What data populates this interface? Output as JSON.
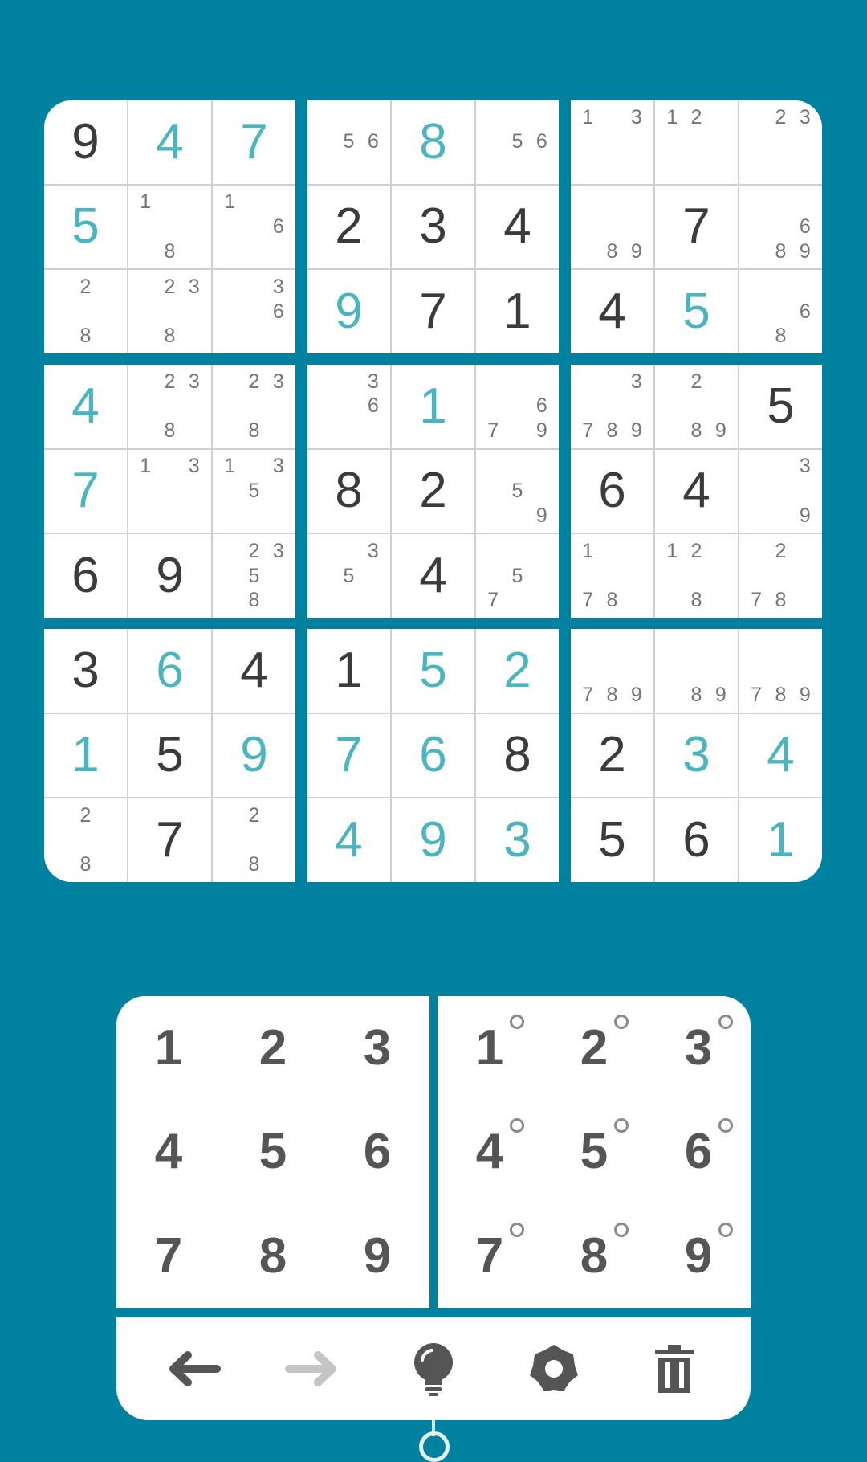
{
  "colors": {
    "background": "#00819f",
    "given": "#3b3b3b",
    "entered": "#4ab4bf",
    "notes": "#757575"
  },
  "board": [
    [
      {
        "v": "9",
        "t": "given"
      },
      {
        "v": "4",
        "t": "entered"
      },
      {
        "v": "7",
        "t": "entered"
      },
      {
        "n": [
          "5",
          "6"
        ]
      },
      {
        "v": "8",
        "t": "entered"
      },
      {
        "n": [
          "5",
          "6"
        ]
      },
      {
        "n": [
          "1",
          "3"
        ]
      },
      {
        "n": [
          "1",
          "2"
        ]
      },
      {
        "n": [
          "2",
          "3"
        ]
      }
    ],
    [
      {
        "v": "5",
        "t": "entered"
      },
      {
        "n": [
          "1",
          "8"
        ]
      },
      {
        "n": [
          "1",
          "6"
        ]
      },
      {
        "v": "2",
        "t": "given"
      },
      {
        "v": "3",
        "t": "given"
      },
      {
        "v": "4",
        "t": "given"
      },
      {
        "n": [
          "8",
          "9"
        ]
      },
      {
        "v": "7",
        "t": "given"
      },
      {
        "n": [
          "6",
          "8",
          "9"
        ]
      }
    ],
    [
      {
        "n": [
          "2",
          "8"
        ]
      },
      {
        "n": [
          "2",
          "3",
          "8"
        ]
      },
      {
        "n": [
          "3",
          "6"
        ]
      },
      {
        "v": "9",
        "t": "entered"
      },
      {
        "v": "7",
        "t": "given"
      },
      {
        "v": "1",
        "t": "given"
      },
      {
        "v": "4",
        "t": "given"
      },
      {
        "v": "5",
        "t": "entered"
      },
      {
        "n": [
          "6",
          "8"
        ]
      }
    ],
    [
      {
        "v": "4",
        "t": "entered"
      },
      {
        "n": [
          "2",
          "3",
          "8"
        ]
      },
      {
        "n": [
          "2",
          "3",
          "8"
        ]
      },
      {
        "n": [
          "3",
          "6"
        ]
      },
      {
        "v": "1",
        "t": "entered"
      },
      {
        "n": [
          "6",
          "7",
          "9"
        ]
      },
      {
        "n": [
          "3",
          "7",
          "8",
          "9"
        ]
      },
      {
        "n": [
          "2",
          "8",
          "9"
        ]
      },
      {
        "v": "5",
        "t": "given"
      }
    ],
    [
      {
        "v": "7",
        "t": "entered"
      },
      {
        "n": [
          "1",
          "3"
        ]
      },
      {
        "n": [
          "1",
          "3",
          "5"
        ]
      },
      {
        "v": "8",
        "t": "given"
      },
      {
        "v": "2",
        "t": "given"
      },
      {
        "n": [
          "5",
          "9"
        ]
      },
      {
        "v": "6",
        "t": "given"
      },
      {
        "v": "4",
        "t": "given"
      },
      {
        "n": [
          "3",
          "9"
        ]
      }
    ],
    [
      {
        "v": "6",
        "t": "given"
      },
      {
        "v": "9",
        "t": "given"
      },
      {
        "n": [
          "2",
          "3",
          "5",
          "8"
        ]
      },
      {
        "n": [
          "3",
          "5"
        ]
      },
      {
        "v": "4",
        "t": "given"
      },
      {
        "n": [
          "5",
          "7"
        ]
      },
      {
        "n": [
          "1",
          "7",
          "8"
        ]
      },
      {
        "n": [
          "1",
          "2",
          "8"
        ]
      },
      {
        "n": [
          "2",
          "7",
          "8"
        ]
      }
    ],
    [
      {
        "v": "3",
        "t": "given"
      },
      {
        "v": "6",
        "t": "entered"
      },
      {
        "v": "4",
        "t": "given"
      },
      {
        "v": "1",
        "t": "given"
      },
      {
        "v": "5",
        "t": "entered"
      },
      {
        "v": "2",
        "t": "entered"
      },
      {
        "n": [
          "7",
          "8",
          "9"
        ]
      },
      {
        "n": [
          "8",
          "9"
        ]
      },
      {
        "n": [
          "7",
          "8",
          "9"
        ]
      }
    ],
    [
      {
        "v": "1",
        "t": "entered"
      },
      {
        "v": "5",
        "t": "given"
      },
      {
        "v": "9",
        "t": "entered"
      },
      {
        "v": "7",
        "t": "entered"
      },
      {
        "v": "6",
        "t": "entered"
      },
      {
        "v": "8",
        "t": "given"
      },
      {
        "v": "2",
        "t": "given"
      },
      {
        "v": "3",
        "t": "entered"
      },
      {
        "v": "4",
        "t": "entered"
      }
    ],
    [
      {
        "n": [
          "2",
          "8"
        ]
      },
      {
        "v": "7",
        "t": "given"
      },
      {
        "n": [
          "2",
          "8"
        ]
      },
      {
        "v": "4",
        "t": "entered"
      },
      {
        "v": "9",
        "t": "entered"
      },
      {
        "v": "3",
        "t": "entered"
      },
      {
        "v": "5",
        "t": "given"
      },
      {
        "v": "6",
        "t": "given"
      },
      {
        "v": "1",
        "t": "entered"
      }
    ]
  ],
  "keypad": {
    "numbers": [
      "1",
      "2",
      "3",
      "4",
      "5",
      "6",
      "7",
      "8",
      "9"
    ],
    "note_numbers": [
      "1",
      "2",
      "3",
      "4",
      "5",
      "6",
      "7",
      "8",
      "9"
    ]
  },
  "toolbar": {
    "undo_icon": "arrow-left-icon",
    "redo_icon": "arrow-right-icon",
    "hint_icon": "lightbulb-icon",
    "settings_icon": "gear-icon",
    "delete_icon": "trash-icon"
  }
}
